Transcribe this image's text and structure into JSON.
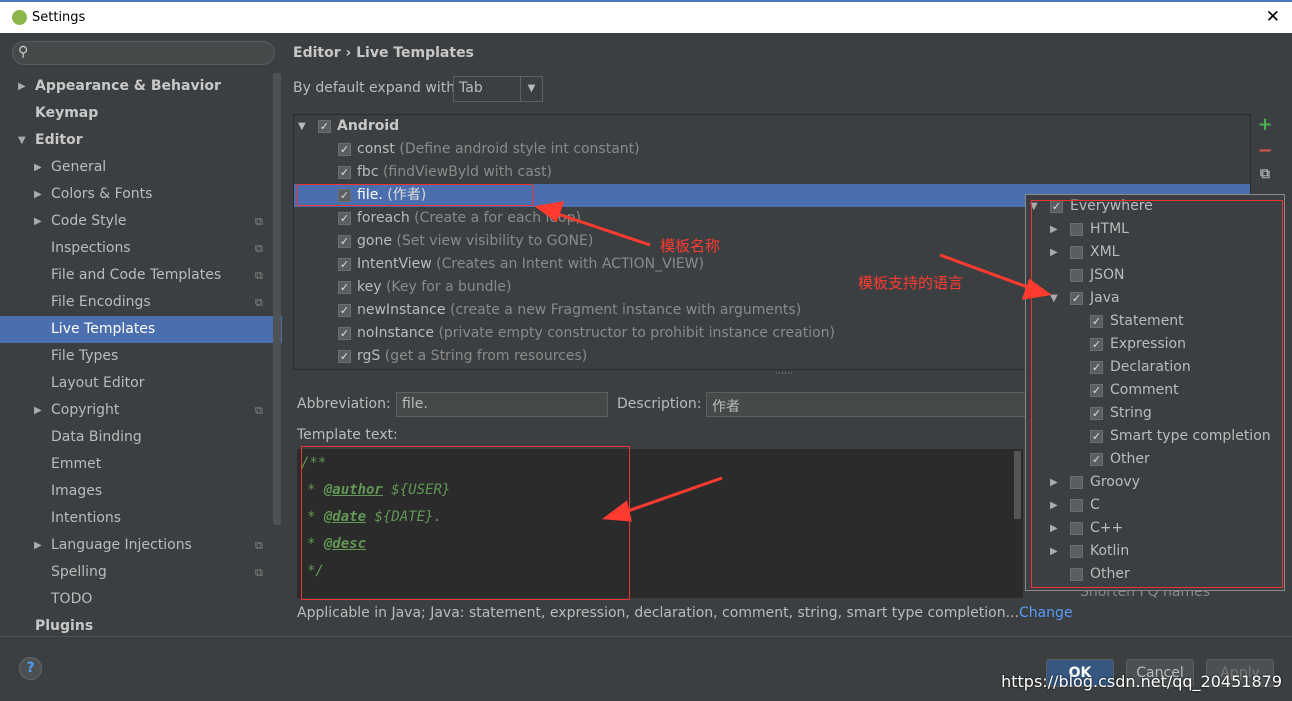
{
  "window": {
    "title": "Settings",
    "close": "✕"
  },
  "sidebar": {
    "search_icon": "search-icon",
    "items": [
      {
        "label": "Appearance & Behavior",
        "level": 0,
        "arrow": "▶",
        "bold": true
      },
      {
        "label": "Keymap",
        "level": 0,
        "bold": true
      },
      {
        "label": "Editor",
        "level": 0,
        "arrow": "▼",
        "bold": true
      },
      {
        "label": "General",
        "level": 1,
        "arrow": "▶"
      },
      {
        "label": "Colors & Fonts",
        "level": 1,
        "arrow": "▶"
      },
      {
        "label": "Code Style",
        "level": 1,
        "arrow": "▶",
        "copy": true
      },
      {
        "label": "Inspections",
        "level": 1,
        "copy": true
      },
      {
        "label": "File and Code Templates",
        "level": 1,
        "copy": true
      },
      {
        "label": "File Encodings",
        "level": 1,
        "copy": true
      },
      {
        "label": "Live Templates",
        "level": 1,
        "selected": true
      },
      {
        "label": "File Types",
        "level": 1
      },
      {
        "label": "Layout Editor",
        "level": 1
      },
      {
        "label": "Copyright",
        "level": 1,
        "arrow": "▶",
        "copy": true
      },
      {
        "label": "Data Binding",
        "level": 1
      },
      {
        "label": "Emmet",
        "level": 1
      },
      {
        "label": "Images",
        "level": 1
      },
      {
        "label": "Intentions",
        "level": 1
      },
      {
        "label": "Language Injections",
        "level": 1,
        "arrow": "▶",
        "copy": true
      },
      {
        "label": "Spelling",
        "level": 1,
        "copy": true
      },
      {
        "label": "TODO",
        "level": 1
      },
      {
        "label": "Plugins",
        "level": 0,
        "bold": true
      }
    ]
  },
  "main": {
    "breadcrumb": "Editor › Live Templates",
    "expand_label": "By default expand with",
    "expand_value": "Tab",
    "group": {
      "name": "Android",
      "checked": true
    },
    "templates": [
      {
        "abbr": "const",
        "desc": "(Define android style int constant)"
      },
      {
        "abbr": "fbc",
        "desc": "(findViewByld with cast)"
      },
      {
        "abbr": "file.",
        "desc": "(作者)",
        "selected": true
      },
      {
        "abbr": "foreach",
        "desc": "(Create a for each loop)"
      },
      {
        "abbr": "gone",
        "desc": "(Set view visibility to GONE)"
      },
      {
        "abbr": "IntentView",
        "desc": "(Creates an Intent with ACTION_VIEW)"
      },
      {
        "abbr": "key",
        "desc": "(Key for a bundle)"
      },
      {
        "abbr": "newInstance",
        "desc": "(create a new Fragment instance with arguments)"
      },
      {
        "abbr": "noInstance",
        "desc": "(private empty constructor to prohibit instance creation)"
      },
      {
        "abbr": "rgS",
        "desc": "(get a String from resources)"
      }
    ],
    "tools": {
      "add": "+",
      "remove": "−",
      "copy": "⧉"
    },
    "abbreviation_label": "Abbreviation:",
    "abbreviation_value": "file.",
    "description_label": "Description:",
    "description_value": "作者",
    "template_text_label": "Template text:",
    "code": [
      "/**",
      "* @author  ${USER}",
      "* @date  ${DATE}.",
      "* @desc",
      "*/"
    ],
    "applicable_text": "Applicable in Java; Java: statement, expression, declaration, comment, string, smart type completion...",
    "change_link": "Change",
    "hidden_option": "Shorten FQ names"
  },
  "context_popup": {
    "items": [
      {
        "label": "Everywhere",
        "level": 0,
        "arrow": "▼",
        "checked": true
      },
      {
        "label": "HTML",
        "level": 1,
        "arrow": "▶"
      },
      {
        "label": "XML",
        "level": 1,
        "arrow": "▶"
      },
      {
        "label": "JSON",
        "level": 1
      },
      {
        "label": "Java",
        "level": 1,
        "arrow": "▼",
        "checked": true
      },
      {
        "label": "Statement",
        "level": 2,
        "checked": true
      },
      {
        "label": "Expression",
        "level": 2,
        "checked": true
      },
      {
        "label": "Declaration",
        "level": 2,
        "checked": true
      },
      {
        "label": "Comment",
        "level": 2,
        "checked": true
      },
      {
        "label": "String",
        "level": 2,
        "checked": true
      },
      {
        "label": "Smart type completion",
        "level": 2,
        "checked": true
      },
      {
        "label": "Other",
        "level": 2,
        "checked": true
      },
      {
        "label": "Groovy",
        "level": 1,
        "arrow": "▶"
      },
      {
        "label": "C",
        "level": 1,
        "arrow": "▶"
      },
      {
        "label": "C++",
        "level": 1,
        "arrow": "▶"
      },
      {
        "label": "Kotlin",
        "level": 1,
        "arrow": "▶"
      },
      {
        "label": "Other",
        "level": 1
      }
    ]
  },
  "footer": {
    "help": "?",
    "ok": "OK",
    "cancel": "Cancel",
    "apply": "Apply"
  },
  "annotations": {
    "template_name": "模板名称",
    "supported_languages": "模板支持的语言"
  },
  "watermark": "https://blog.csdn.net/qq_20451879",
  "colors": {
    "background": "#3c3f41",
    "selection": "#4b6eaf",
    "annotation": "#ff3b30",
    "code_comment": "#629755",
    "link": "#589df6"
  }
}
